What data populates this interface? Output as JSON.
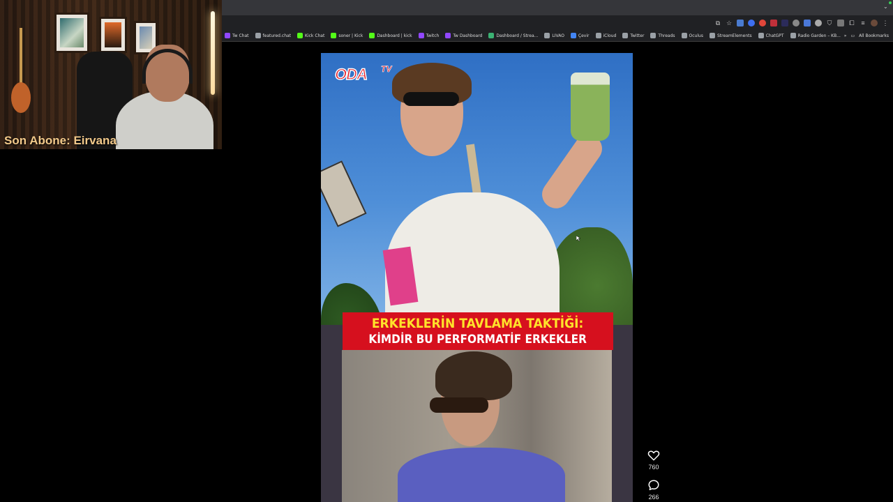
{
  "webcam": {
    "overlay_text": "Son Abone: Eirvana"
  },
  "bookmarks": [
    {
      "label": "Tw Chat",
      "color": "#9147ff"
    },
    {
      "label": "featured.chat",
      "color": "#9aa0a6"
    },
    {
      "label": "Kick Chat",
      "color": "#53fc18"
    },
    {
      "label": "soner | Kick",
      "color": "#53fc18"
    },
    {
      "label": "Dashboard | kick",
      "color": "#53fc18"
    },
    {
      "label": "Twitch",
      "color": "#9147ff"
    },
    {
      "label": "Tw Dashboard",
      "color": "#9147ff"
    },
    {
      "label": "Dashboard / Strea...",
      "color": "#3bb273"
    },
    {
      "label": "LIVAO",
      "color": "#9aa0a6"
    },
    {
      "label": "Çevir",
      "color": "#4285f4"
    },
    {
      "label": "iCloud",
      "color": "#9aa0a6"
    },
    {
      "label": "Twitter",
      "color": "#9aa0a6"
    },
    {
      "label": "Threads",
      "color": "#9aa0a6"
    },
    {
      "label": "Oculus",
      "color": "#9aa0a6"
    },
    {
      "label": "StreamElements",
      "color": "#9aa0a6"
    },
    {
      "label": "ChatGPT",
      "color": "#9aa0a6"
    },
    {
      "label": "Radio Garden – KB...",
      "color": "#9aa0a6"
    }
  ],
  "bookmarks_right": {
    "more": "»",
    "all_bookmarks": "All Bookmarks"
  },
  "video": {
    "logo_main": "ODA",
    "logo_suffix": "TV",
    "headline_line1": "ERKEKLERİN TAVLAMA TAKTİĞİ:",
    "headline_line2": "KİMDİR BU PERFORMATİF ERKEKLER"
  },
  "actions": {
    "likes": "760",
    "comments": "266"
  },
  "colors": {
    "banner_bg": "#d6101e",
    "banner_line1": "#ffe22b",
    "logo_red": "#e01e2a"
  }
}
